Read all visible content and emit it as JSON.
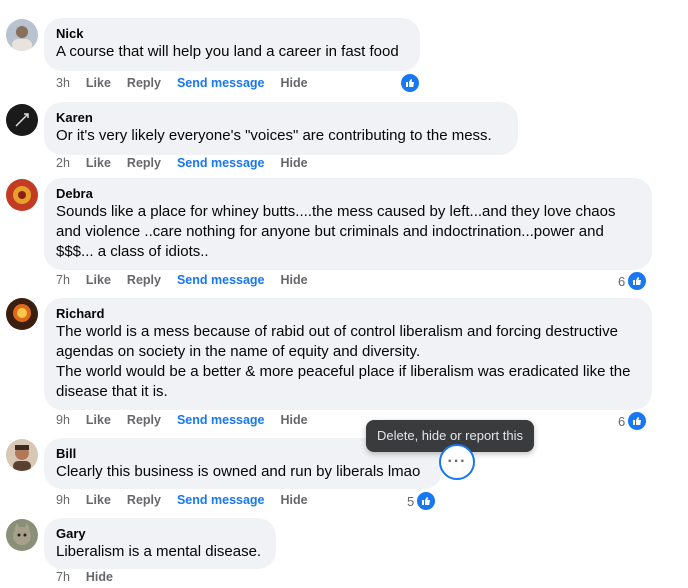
{
  "comments": [
    {
      "author": "Nick",
      "text": "A course that will help you land a career in fast food",
      "time": "3h",
      "actions": [
        "Like",
        "Reply",
        "Send message",
        "Hide"
      ],
      "reaction_count": "",
      "avatar_color": "#b9c2cf"
    },
    {
      "author": "Karen",
      "text": "Or it's very likely everyone's \"voices\" are contributing to the mess.",
      "time": "2h",
      "actions": [
        "Like",
        "Reply",
        "Send message",
        "Hide"
      ],
      "reaction_count": "",
      "avatar_color": "#1a1a1a"
    },
    {
      "author": "Debra",
      "text": "Sounds like a place for whiney butts....the mess caused by left...and they love chaos and violence ..care nothing for anyone but criminals and indoctrination...power and $$$... a class of idiots..",
      "time": "7h",
      "actions": [
        "Like",
        "Reply",
        "Send message",
        "Hide"
      ],
      "reaction_count": "6",
      "avatar_color": "#c23b22"
    },
    {
      "author": "Richard",
      "text": "The world is a mess because of rabid out of control liberalism and forcing destructive agendas on society in the name of equity and diversity.\nThe world would be a better & more peaceful place if liberalism was eradicated like the disease that it is.",
      "time": "9h",
      "actions": [
        "Like",
        "Reply",
        "Send message",
        "Hide"
      ],
      "reaction_count": "6",
      "avatar_color": "#e06a1a"
    },
    {
      "author": "Bill",
      "text": "Clearly this business is owned and run by liberals lmao",
      "time": "9h",
      "actions": [
        "Like",
        "Reply",
        "Send message",
        "Hide"
      ],
      "reaction_count": "5",
      "avatar_color": "#6b4a3a"
    },
    {
      "author": "Gary",
      "text": "Liberalism is a mental disease.",
      "time": "7h",
      "actions": [
        "Hide"
      ],
      "reaction_count": "",
      "avatar_color": "#8a8f7a"
    }
  ],
  "tooltip": "Delete, hide or report this",
  "more_button_icon": "ellipsis-icon",
  "colors": {
    "accent": "#1877f2",
    "bubble": "#f0f2f5",
    "meta": "#65676b"
  }
}
